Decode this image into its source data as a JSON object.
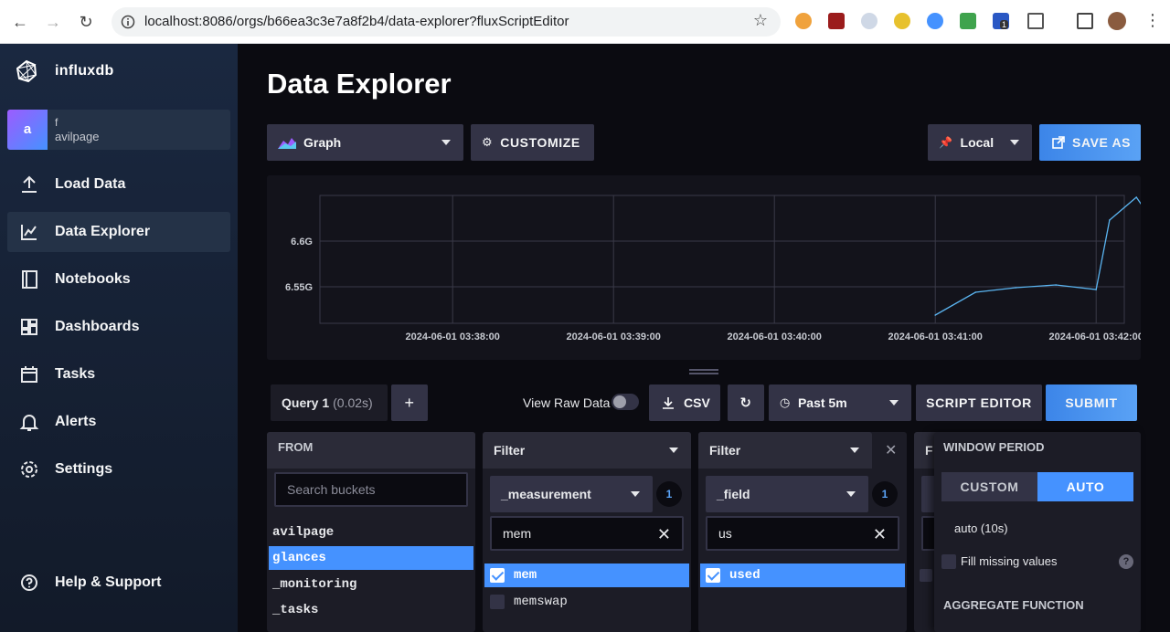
{
  "browser": {
    "url": "localhost:8086/orgs/b66ea3c3e7a8f2b4/data-explorer?fluxScriptEditor",
    "extension_badge": "1"
  },
  "sidebar": {
    "logo_text": "influxdb",
    "user": {
      "avatar_letter": "a",
      "name": "f",
      "org": "avilpage"
    },
    "items": [
      {
        "label": "Load Data",
        "icon": "upload-icon"
      },
      {
        "label": "Data Explorer",
        "icon": "graph-line-icon",
        "active": true
      },
      {
        "label": "Notebooks",
        "icon": "notebook-icon"
      },
      {
        "label": "Dashboards",
        "icon": "dashboard-icon"
      },
      {
        "label": "Tasks",
        "icon": "calendar-icon"
      },
      {
        "label": "Alerts",
        "icon": "bell-icon"
      },
      {
        "label": "Settings",
        "icon": "gear-icon"
      }
    ],
    "help_label": "Help & Support"
  },
  "header": {
    "title": "Data Explorer",
    "vis_type": "Graph",
    "customize_label": "CUSTOMIZE",
    "timezone": "Local",
    "save_as_label": "SAVE AS"
  },
  "chart_data": {
    "type": "line",
    "y_ticks": [
      "6.6G",
      "6.55G"
    ],
    "x_ticks": [
      "2024-06-01 03:38:00",
      "2024-06-01 03:39:00",
      "2024-06-01 03:40:00",
      "2024-06-01 03:41:00",
      "2024-06-01 03:42:00"
    ],
    "series": [
      {
        "color": "#5ab4f0",
        "points": [
          [
            "03:41:00",
            6.519
          ],
          [
            "03:41:15",
            6.544
          ],
          [
            "03:41:30",
            6.549
          ],
          [
            "03:41:45",
            6.552
          ],
          [
            "03:42:00",
            6.547
          ],
          [
            "03:42:05",
            6.623
          ],
          [
            "03:42:15",
            6.648
          ],
          [
            "03:42:30",
            6.585
          ],
          [
            "03:42:40",
            6.622
          ]
        ]
      }
    ],
    "ylim": [
      6.51,
      6.65
    ],
    "grid": true
  },
  "query_bar": {
    "query_tab": "Query 1",
    "query_time": "(0.02s)",
    "add_label": "+",
    "raw_data_label": "View Raw Data",
    "csv_label": "CSV",
    "time_range": "Past 5m",
    "script_editor_label": "SCRIPT EDITOR",
    "submit_label": "SUBMIT"
  },
  "from_panel": {
    "header": "FROM",
    "search_placeholder": "Search buckets",
    "buckets": [
      "avilpage",
      "glances",
      "_monitoring",
      "_tasks"
    ],
    "selected": "glances"
  },
  "filter1": {
    "header": "Filter",
    "key": "_measurement",
    "count": "1",
    "search_value": "mem",
    "values": [
      {
        "label": "mem",
        "checked": true
      },
      {
        "label": "memswap",
        "checked": false
      }
    ]
  },
  "filter2": {
    "header": "Filter",
    "key": "_field",
    "count": "1",
    "search_value": "us",
    "values": [
      {
        "label": "used",
        "checked": true
      }
    ]
  },
  "filter3": {
    "header_letter": "F"
  },
  "window_panel": {
    "header": "WINDOW PERIOD",
    "custom_label": "CUSTOM",
    "auto_label": "AUTO",
    "auto_value": "auto (10s)",
    "fill_label": "Fill missing values",
    "aggregate_header": "AGGREGATE FUNCTION"
  }
}
